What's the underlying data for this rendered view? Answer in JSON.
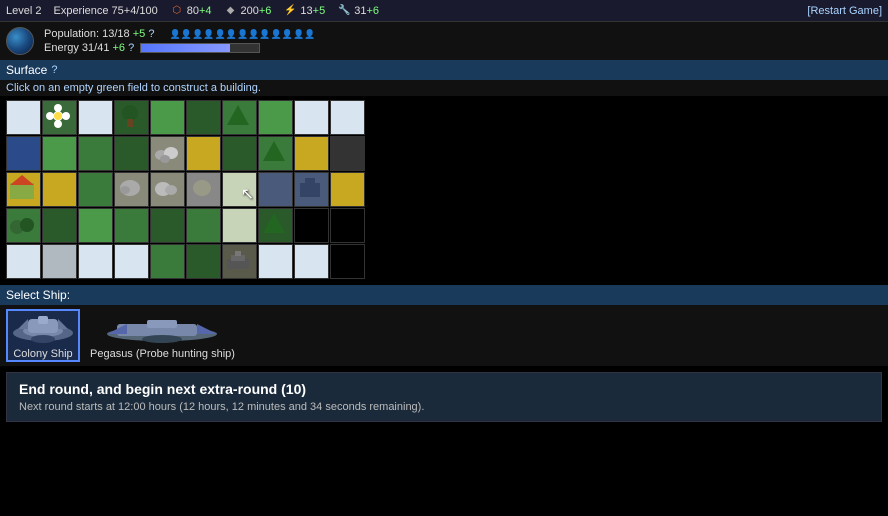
{
  "topBar": {
    "level": "Level 2",
    "experience": "Experience",
    "expValue": "75+4/100",
    "stats": [
      {
        "icon": "⚙",
        "value": "80+4",
        "color": "#dd6633"
      },
      {
        "icon": "🪨",
        "value": "200+6",
        "color": "#aaaaaa"
      },
      {
        "icon": "⚡",
        "value": "13+5",
        "color": "#ffdd44"
      },
      {
        "icon": "🔧",
        "value": "31+6",
        "color": "#88aaff"
      }
    ],
    "restartLabel": "[Restart Game]"
  },
  "planet": {
    "populationLabel": "Population: 13/18",
    "populationBonus": "+5",
    "energyLabel": "Energy 31/41",
    "energyBonus": "+6",
    "energyPercent": 75
  },
  "surface": {
    "title": "Surface",
    "instruction": "Click on an empty green field to construct a building."
  },
  "selectShip": {
    "label": "Select Ship:",
    "ships": [
      {
        "name": "Colony Ship",
        "selected": true
      },
      {
        "name": "Pegasus (Probe hunting ship)",
        "selected": false
      }
    ]
  },
  "endRound": {
    "title": "End round, and begin next extra-round (10)",
    "subtitle": "Next round starts at 12:00 hours (12 hours, 12 minutes and 34 seconds remaining)."
  },
  "grid": {
    "rows": 5,
    "cols": 10
  }
}
